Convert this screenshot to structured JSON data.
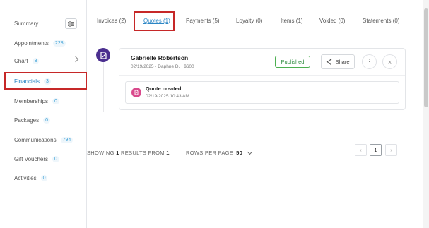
{
  "sidebar": {
    "items": [
      {
        "label": "Summary",
        "count": ""
      },
      {
        "label": "Appointments",
        "count": "228"
      },
      {
        "label": "Chart",
        "count": "3"
      },
      {
        "label": "Financials",
        "count": "3"
      },
      {
        "label": "Memberships",
        "count": "0"
      },
      {
        "label": "Packages",
        "count": "0"
      },
      {
        "label": "Communications",
        "count": "794"
      },
      {
        "label": "Gift Vouchers",
        "count": "0"
      },
      {
        "label": "Activities",
        "count": "0"
      }
    ],
    "active": "Financials"
  },
  "tabs": [
    {
      "label": "Invoices (2)"
    },
    {
      "label": "Quotes (1)"
    },
    {
      "label": "Payments (5)"
    },
    {
      "label": "Loyalty (0)"
    },
    {
      "label": "Items (1)"
    },
    {
      "label": "Voided (0)"
    },
    {
      "label": "Statements (0)"
    }
  ],
  "quote": {
    "name": "Gabrielle Robertson",
    "meta": "02/19/2025  ·  Daphne D.  ·  $600",
    "status": "Published",
    "share_label": "Share",
    "activity": {
      "title": "Quote created",
      "time": "02/19/2025 10:43 AM"
    }
  },
  "pagination": {
    "showing_prefix": "SHOWING",
    "result_count": "1",
    "results_mid": "RESULTS FROM",
    "result_total": "1",
    "rows_label": "ROWS PER PAGE",
    "rows_value": "50",
    "current_page": "1"
  },
  "colors": {
    "accent": "#2b86c5",
    "highlight": "#c62828",
    "published": "#4caf50",
    "avatar": "#4b2f8f",
    "activity_dot": "#d94a8c"
  },
  "icons": [
    "filter-icon",
    "chevron-right-icon",
    "share-icon",
    "more-icon",
    "close-icon",
    "quote-icon",
    "document-icon",
    "chevron-left-icon",
    "chevron-down-icon"
  ]
}
